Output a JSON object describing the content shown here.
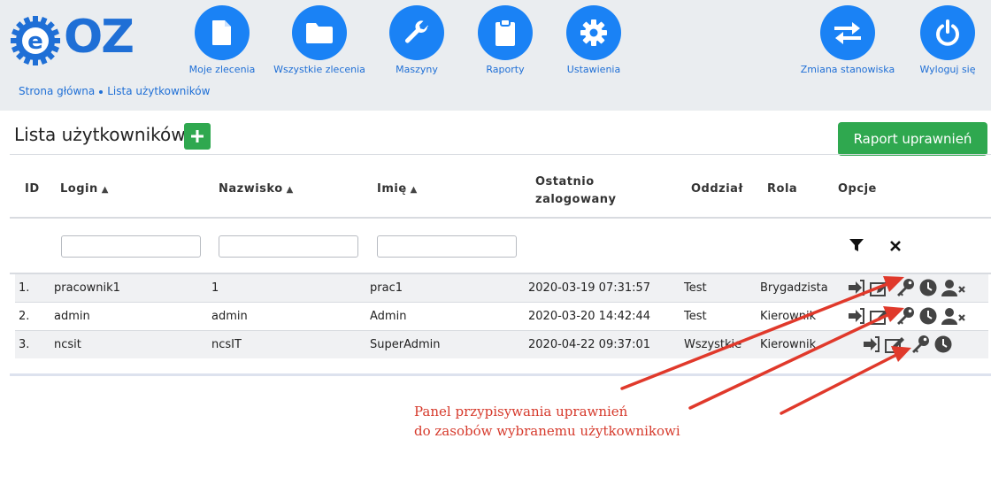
{
  "brand": {
    "logo_text": "OZ",
    "accent": "#1a82f5",
    "green": "#2fa84f"
  },
  "nav": [
    {
      "label": "Moje zlecenia",
      "icon": "document-icon"
    },
    {
      "label": "Wszystkie zlecenia",
      "icon": "folder-icon"
    },
    {
      "label": "Maszyny",
      "icon": "wrench-icon"
    },
    {
      "label": "Raporty",
      "icon": "clipboard-icon"
    },
    {
      "label": "Ustawienia",
      "icon": "gear-icon"
    },
    {
      "label": "Zmiana stanowiska",
      "icon": "swap-icon"
    },
    {
      "label": "Wyloguj się",
      "icon": "power-icon"
    }
  ],
  "breadcrumb": {
    "home": "Strona główna",
    "current": "Lista użytkowników"
  },
  "page": {
    "title": "Lista użytkowników",
    "report_button": "Raport uprawnień"
  },
  "table": {
    "headers": {
      "id": "ID",
      "login": "Login",
      "nazwisko": "Nazwisko",
      "imie": "Imię",
      "ostatnio_1": "Ostatnio",
      "ostatnio_2": "zalogowany",
      "oddzial": "Oddział",
      "rola": "Rola",
      "opcje": "Opcje"
    },
    "filters": {
      "login": "",
      "nazwisko": "",
      "imie": ""
    },
    "rows": [
      {
        "id": "1.",
        "login": "pracownik1",
        "nazwisko": "1",
        "imie": "prac1",
        "last_login": "2020-03-19 07:31:57",
        "oddzial": "Test",
        "rola": "Brygadzista"
      },
      {
        "id": "2.",
        "login": "admin",
        "nazwisko": "admin",
        "imie": "Admin",
        "last_login": "2020-03-20 14:42:44",
        "oddzial": "Test",
        "rola": "Kierownik"
      },
      {
        "id": "3.",
        "login": "ncsit",
        "nazwisko": "ncsIT",
        "imie": "SuperAdmin",
        "last_login": "2020-04-22 09:37:01",
        "oddzial": "Wszystkie",
        "rola": "Kierownik"
      }
    ]
  },
  "annotation": {
    "line1": "Panel przypisywania uprawnień",
    "line2": "do zasobów wybranemu użytkownikowi",
    "color": "#d63a2c"
  }
}
